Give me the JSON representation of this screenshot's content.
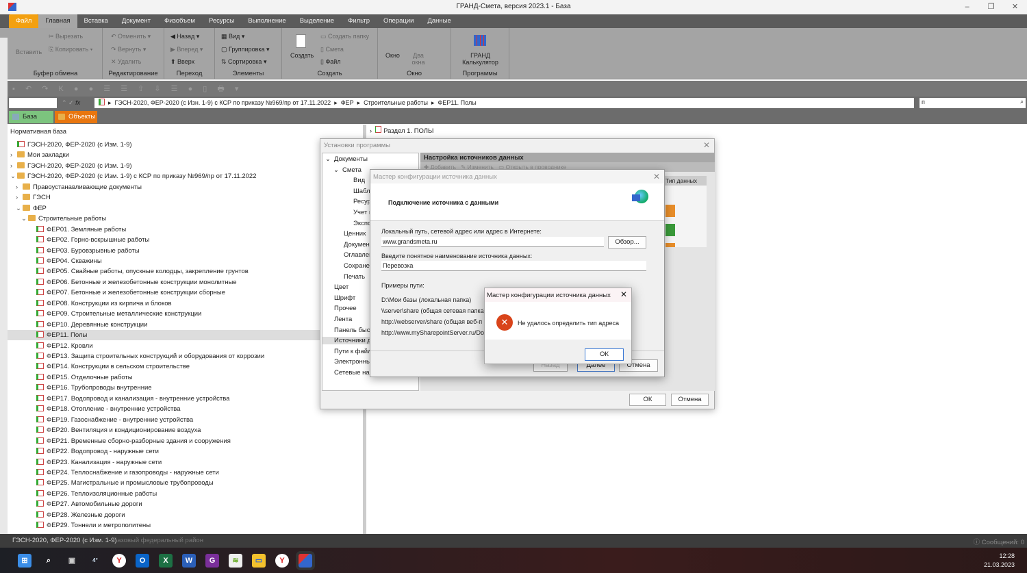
{
  "app": {
    "title": "ГРАНД-Смета, версия 2023.1 - База"
  },
  "menu_tabs": [
    "Файл",
    "Главная",
    "Вставка",
    "Документ",
    "Физобъем",
    "Ресурсы",
    "Выполнение",
    "Выделение",
    "Фильтр",
    "Операции",
    "Данные"
  ],
  "ribbon": {
    "clipboard": {
      "label": "Буфер обмена",
      "paste": "Вставить",
      "cut": "Вырезать",
      "copy": "Копировать"
    },
    "edit": {
      "label": "Редактирование",
      "undo": "Отменить",
      "redo": "Вернуть",
      "delete": "Удалить"
    },
    "nav": {
      "label": "Переход",
      "back": "Назад",
      "forward": "Вперед",
      "up": "Вверх"
    },
    "elements": {
      "label": "Элементы",
      "view": "Вид",
      "group": "Группировка",
      "sort": "Сортировка"
    },
    "create": {
      "label": "Создать",
      "create": "Создать",
      "folder": "Создать папку",
      "estimate": "Смета",
      "file": "Файл"
    },
    "window": {
      "label": "Окно",
      "window": "Окно",
      "two": "Два окна"
    },
    "programs": {
      "label": "Программы",
      "calc1": "ГРАНД",
      "calc2": "Калькулятор"
    }
  },
  "breadcrumb": [
    "ГЭСН-2020, ФЕР-2020 (с Изн. 1-9) с КСР по приказу №969/пр от 17.11.2022",
    "ФЕР",
    "Строительные работы",
    "ФЕР11. Полы"
  ],
  "search": {
    "value": "п"
  },
  "panel_tabs": {
    "base": "База",
    "objects": "Объекты"
  },
  "left": {
    "header": "Нормативная база",
    "items": [
      {
        "t": "ГЭСН-2020, ФЕР-2020 (с Изм. 1-9)",
        "lvl": 0,
        "k": "db",
        "c": ""
      },
      {
        "t": "Мои закладки",
        "lvl": 0,
        "k": "fold",
        "c": "›"
      },
      {
        "t": "ГЭСН-2020, ФЕР-2020 (с Изм. 1-9)",
        "lvl": 0,
        "k": "fold",
        "c": "›"
      },
      {
        "t": "ГЭСН-2020, ФЕР-2020 (с Изм. 1-9) с КСР по приказу №969/пр от 17.11.2022",
        "lvl": 0,
        "k": "fold",
        "c": "⌄"
      },
      {
        "t": "Правоустанавливающие документы",
        "lvl": 1,
        "k": "fold",
        "c": "›"
      },
      {
        "t": "ГЭСН",
        "lvl": 1,
        "k": "fold",
        "c": "›"
      },
      {
        "t": "ФЕР",
        "lvl": 1,
        "k": "fold",
        "c": "⌄"
      },
      {
        "t": "Строительные работы",
        "lvl": 2,
        "k": "fold",
        "c": "⌄"
      },
      {
        "t": "ФЕР01. Земляные работы",
        "lvl": 3,
        "k": "doc"
      },
      {
        "t": "ФЕР02. Горно-вскрышные работы",
        "lvl": 3,
        "k": "doc"
      },
      {
        "t": "ФЕР03. Буровзрывные работы",
        "lvl": 3,
        "k": "doc"
      },
      {
        "t": "ФЕР04. Скважины",
        "lvl": 3,
        "k": "doc"
      },
      {
        "t": "ФЕР05. Свайные работы, опускные колодцы, закрепление грунтов",
        "lvl": 3,
        "k": "doc"
      },
      {
        "t": "ФЕР06. Бетонные и железобетонные конструкции монолитные",
        "lvl": 3,
        "k": "doc"
      },
      {
        "t": "ФЕР07. Бетонные и железобетонные конструкции сборные",
        "lvl": 3,
        "k": "doc"
      },
      {
        "t": "ФЕР08. Конструкции из кирпича и блоков",
        "lvl": 3,
        "k": "doc"
      },
      {
        "t": "ФЕР09. Строительные металлические конструкции",
        "lvl": 3,
        "k": "doc"
      },
      {
        "t": "ФЕР10. Деревянные конструкции",
        "lvl": 3,
        "k": "doc"
      },
      {
        "t": "ФЕР11. Полы",
        "lvl": 3,
        "k": "doc",
        "sel": true
      },
      {
        "t": "ФЕР12. Кровли",
        "lvl": 3,
        "k": "doc"
      },
      {
        "t": "ФЕР13. Защита строительных конструкций и оборудования от коррозии",
        "lvl": 3,
        "k": "doc"
      },
      {
        "t": "ФЕР14. Конструкции в сельском строительстве",
        "lvl": 3,
        "k": "doc"
      },
      {
        "t": "ФЕР15. Отделочные работы",
        "lvl": 3,
        "k": "doc"
      },
      {
        "t": "ФЕР16. Трубопроводы внутренние",
        "lvl": 3,
        "k": "doc"
      },
      {
        "t": "ФЕР17. Водопровод и канализация - внутренние устройства",
        "lvl": 3,
        "k": "doc"
      },
      {
        "t": "ФЕР18. Отопление - внутренние устройства",
        "lvl": 3,
        "k": "doc"
      },
      {
        "t": "ФЕР19. Газоснабжение - внутренние устройства",
        "lvl": 3,
        "k": "doc"
      },
      {
        "t": "ФЕР20. Вентиляция и кондиционирование воздуха",
        "lvl": 3,
        "k": "doc"
      },
      {
        "t": "ФЕР21. Временные сборно-разборные здания и сооружения",
        "lvl": 3,
        "k": "doc"
      },
      {
        "t": "ФЕР22. Водопровод - наружные сети",
        "lvl": 3,
        "k": "doc"
      },
      {
        "t": "ФЕР23. Канализация - наружные сети",
        "lvl": 3,
        "k": "doc"
      },
      {
        "t": "ФЕР24. Теплоснабжение и газопроводы - наружные сети",
        "lvl": 3,
        "k": "doc"
      },
      {
        "t": "ФЕР25. Магистральные и промысловые трубопроводы",
        "lvl": 3,
        "k": "doc"
      },
      {
        "t": "ФЕР26. Теплоизоляционные работы",
        "lvl": 3,
        "k": "doc"
      },
      {
        "t": "ФЕР27. Автомобильные дороги",
        "lvl": 3,
        "k": "doc"
      },
      {
        "t": "ФЕР28. Железные дороги",
        "lvl": 3,
        "k": "doc"
      },
      {
        "t": "ФЕР29. Тоннели и метрополитены",
        "lvl": 3,
        "k": "doc"
      }
    ]
  },
  "right": {
    "section": "Раздел 1. ПОЛЫ"
  },
  "settings": {
    "title": "Установки программы",
    "panel_title": "Настройка источников данных",
    "toolbar": [
      "Добавить",
      "Изменить",
      "Открыть в проводнике"
    ],
    "col_type": "Тип данных",
    "nav": [
      {
        "t": "Документы",
        "lvl": 0,
        "c": "⌄"
      },
      {
        "t": "Смета",
        "lvl": 1,
        "c": "⌄"
      },
      {
        "t": "Вид",
        "lvl": 2
      },
      {
        "t": "Шабл",
        "lvl": 2
      },
      {
        "t": "Ресур",
        "lvl": 2
      },
      {
        "t": "Учет в",
        "lvl": 2
      },
      {
        "t": "Экспо",
        "lvl": 2
      },
      {
        "t": "Ценник",
        "lvl": 1
      },
      {
        "t": "Докумен",
        "lvl": 1
      },
      {
        "t": "Оглавлен",
        "lvl": 1
      },
      {
        "t": "Сохранен",
        "lvl": 1
      },
      {
        "t": "Печать",
        "lvl": 1
      },
      {
        "t": "Цвет",
        "lvl": 0
      },
      {
        "t": "Шрифт",
        "lvl": 0
      },
      {
        "t": "Прочее",
        "lvl": 0
      },
      {
        "t": "Лента",
        "lvl": 0
      },
      {
        "t": "Панель быст",
        "lvl": 0
      },
      {
        "t": "Источники д",
        "lvl": 0,
        "sel": true
      },
      {
        "t": "Пути к файл",
        "lvl": 0
      },
      {
        "t": "Электронны",
        "lvl": 0
      },
      {
        "t": "Сетевые нас",
        "lvl": 0
      }
    ],
    "ok": "ОК",
    "cancel": "Отмена"
  },
  "wizard": {
    "title": "Мастер конфигурации источника данных",
    "heading": "Подключение источника с данными",
    "path_label": "Локальный путь, сетевой адрес или адрес в Интернете:",
    "path_value": "www.grandsmeta.ru",
    "browse": "Обзор...",
    "name_label": "Введите понятное наименование источника данных:",
    "name_value": "Перевозка",
    "examples_label": "Примеры пути:",
    "examples": [
      "D:\\Мои базы (локальная папка)",
      "\\\\server\\share  (общая сетевая папка)",
      "http://webserver/share    (общая веб-п",
      "http://www.mySharepointServer.ru/Doc"
    ],
    "back": "Назад",
    "next": "Далее",
    "cancel": "Отмена"
  },
  "error": {
    "title": "Мастер конфигурации источника данных",
    "message": "Не удалось определить тип адреса",
    "ok": "ОК"
  },
  "status": {
    "db": "ГЭСН-2020, ФЕР-2020 (с Изм. 1-9)",
    "region": "Базовый федеральный район",
    "messages": "Сообщений: 0"
  },
  "taskbar": {
    "weather": "4°",
    "time": "12:28",
    "date": "21.03.2023"
  }
}
